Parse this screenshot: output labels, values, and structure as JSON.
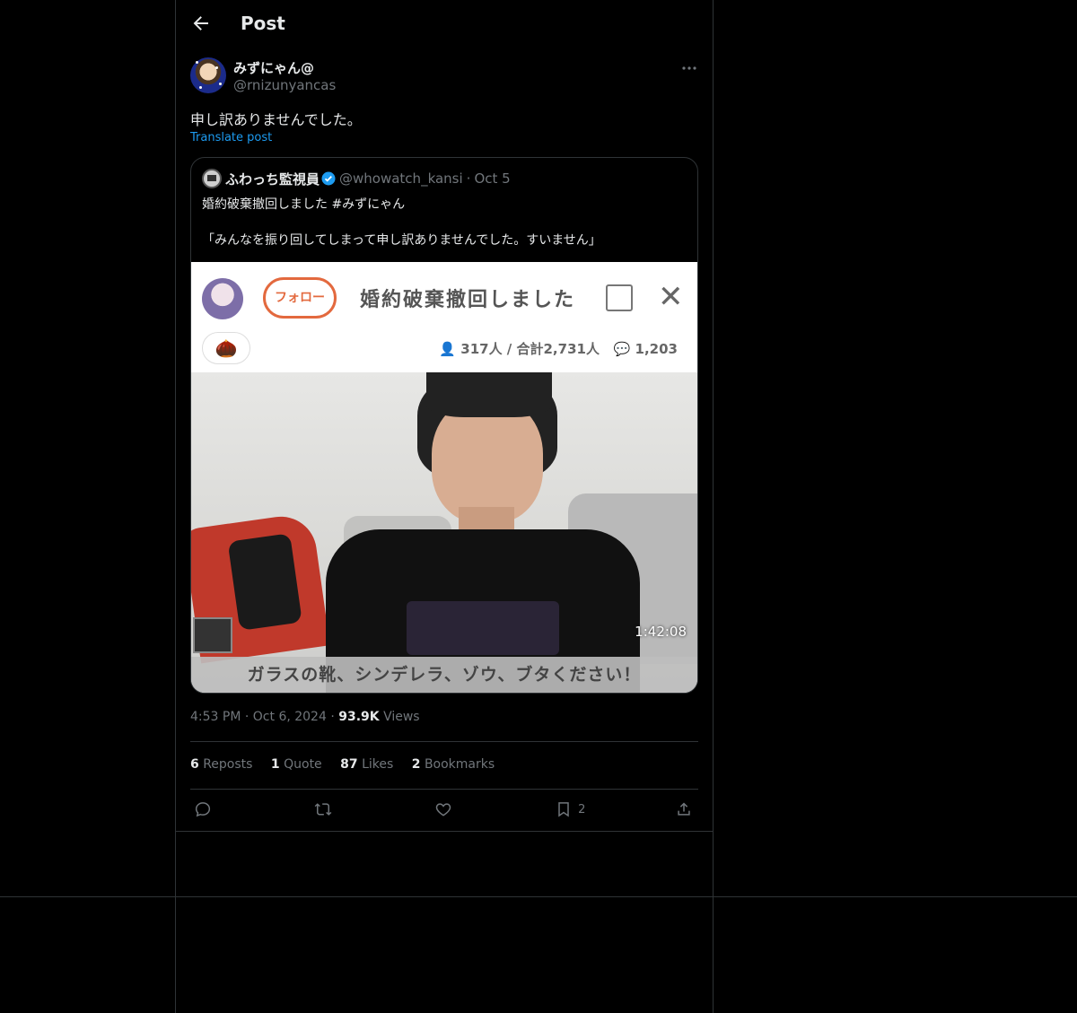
{
  "header": {
    "title": "Post"
  },
  "post": {
    "author_name": "みずにゃん@",
    "author_handle": "@rnizunyancas",
    "text": "申し訳ありませんでした。",
    "translate_label": "Translate post",
    "timestamp": "4:53 PM",
    "date": "Oct 6, 2024",
    "views_count": "93.9K",
    "views_label": "Views"
  },
  "quote": {
    "author_name": "ふわっち監視員",
    "author_handle": "@whowatch_kansi",
    "date": "Oct 5",
    "line1": "婚約破棄撤回しました #みずにゃん",
    "line2": "「みんなを振り回してしまって申し訳ありませんでした。すいません」",
    "media": {
      "follow_label": "フォロー",
      "stream_title": "婚約破棄撤回しました",
      "viewers": "317人 / 合計2,731人",
      "comments": "1,203",
      "duration": "1:42:08",
      "caption": "ガラスの靴、シンデレラ、ゾウ、ブタください！"
    }
  },
  "stats": {
    "reposts_count": "6",
    "reposts_label": "Reposts",
    "quotes_count": "1",
    "quotes_label": "Quote",
    "likes_count": "87",
    "likes_label": "Likes",
    "bookmarks_count": "2",
    "bookmarks_label": "Bookmarks"
  },
  "actions": {
    "reply_icon": "reply-icon",
    "repost_icon": "repost-icon",
    "like_icon": "heart-icon",
    "bookmark_icon": "bookmark-icon",
    "bookmark_count": "2",
    "share_icon": "share-icon"
  },
  "colors": {
    "accent": "#1d9bf0",
    "background": "#000000",
    "border": "#2f3336",
    "muted": "#71767b"
  }
}
